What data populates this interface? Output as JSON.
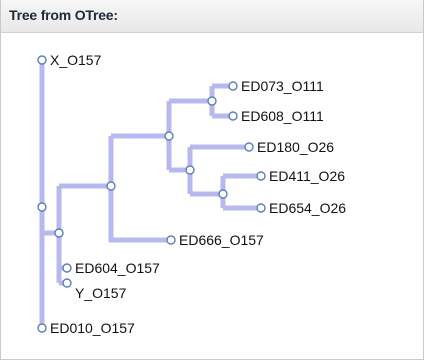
{
  "panel": {
    "title": "Tree from OTree:"
  },
  "tree": {
    "leaves": [
      {
        "id": "x",
        "label": "X_O157"
      },
      {
        "id": "ed073",
        "label": "ED073_O111"
      },
      {
        "id": "ed608",
        "label": "ED608_O111"
      },
      {
        "id": "ed180",
        "label": "ED180_O26"
      },
      {
        "id": "ed411",
        "label": "ED411_O26"
      },
      {
        "id": "ed654",
        "label": "ED654_O26"
      },
      {
        "id": "ed666",
        "label": "ED666_O157"
      },
      {
        "id": "ed604",
        "label": "ED604_O157"
      },
      {
        "id": "y",
        "label": "Y_O157"
      },
      {
        "id": "ed010",
        "label": "ED010_O157"
      }
    ],
    "colors": {
      "link": "#b7b9ee",
      "node_stroke": "#5b7fb8"
    }
  }
}
